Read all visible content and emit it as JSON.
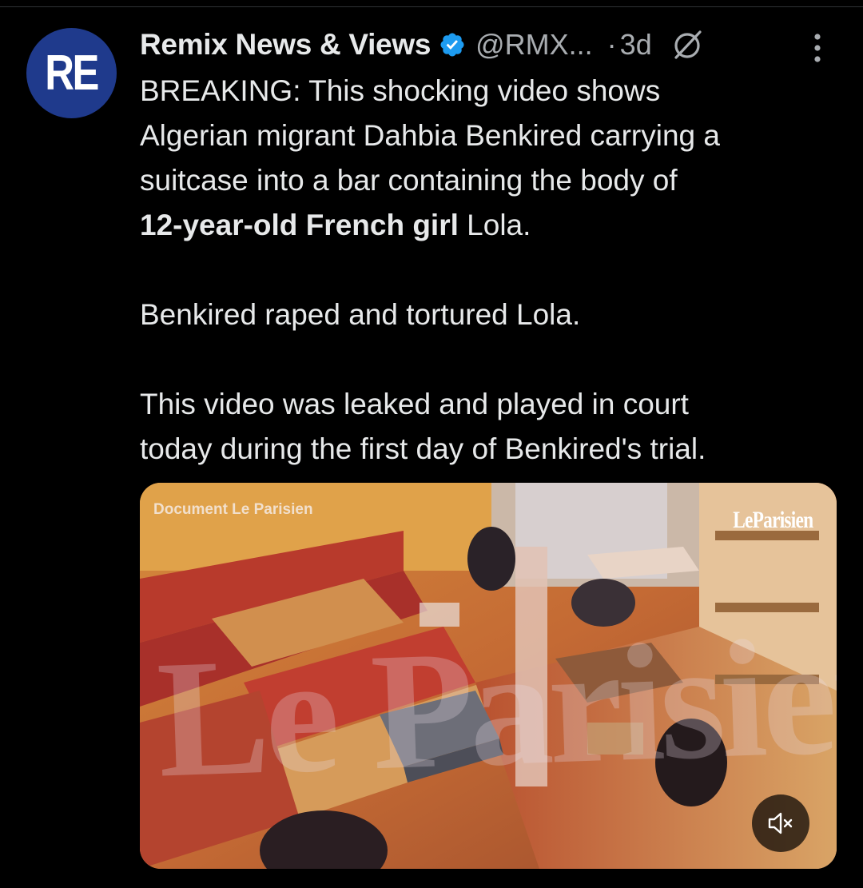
{
  "colors": {
    "background": "#000000",
    "text": "#e7e9ea",
    "muted": "#a9adb1",
    "verified": "#1d9bf0",
    "avatar_bg": "#1f3a8c"
  },
  "post": {
    "avatar_text": "RE",
    "display_name": "Remix News & Views",
    "handle": "@RMX...",
    "separator": "·",
    "timestamp": "3d",
    "icons": {
      "verified": "verified-badge-icon",
      "grok": "grok-icon",
      "more": "more-vertical-icon"
    },
    "text": {
      "line1": "BREAKING: This shocking video shows",
      "line2": "Algerian migrant Dahbia Benkired carrying a",
      "line3": "suitcase into a bar containing the body of",
      "line4_bold": "12-year-old French girl",
      "line4_rest": " Lola.",
      "line5": "Benkired raped and tortured Lola.",
      "line6": "This video was leaked and played in court",
      "line7": "today during the first day of Benkired's trial."
    },
    "media": {
      "document_label": "Document Le Parisien",
      "brand_logo": "LeParisien",
      "watermark": "Le Parisien",
      "mute_icon": "speaker-muted-icon"
    }
  }
}
